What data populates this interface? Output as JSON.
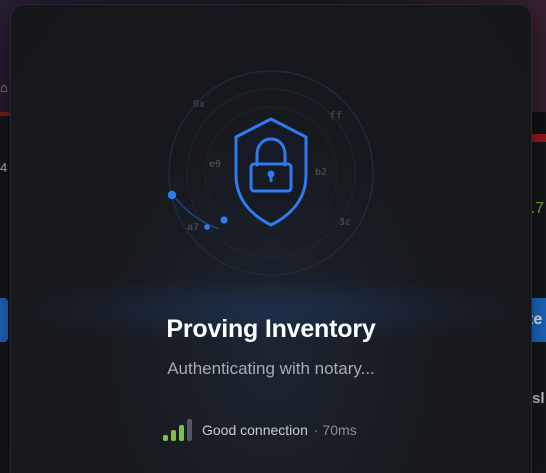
{
  "modal": {
    "title": "Proving Inventory",
    "subtitle": "Authenticating with notary...",
    "emblem_icon": "padlock-shield-icon",
    "hex_fragments": [
      "0x",
      "ff",
      "e9",
      "b2",
      "a7",
      "3c"
    ],
    "connection": {
      "label": "Good connection",
      "latency": "· 70ms",
      "signal_bars_active": 3,
      "signal_bars_total": 4,
      "signal_icon": "signal-strength-icon"
    }
  },
  "background": {
    "right_button_text": "te",
    "right_value": ".7",
    "left_value": "4",
    "right_text": "sl"
  },
  "colors": {
    "accent_blue": "#2f7bf0",
    "signal_green": "#7dc242",
    "signal_inactive": "#555860",
    "title": "#ffffff",
    "subtitle": "#a8abb3"
  }
}
